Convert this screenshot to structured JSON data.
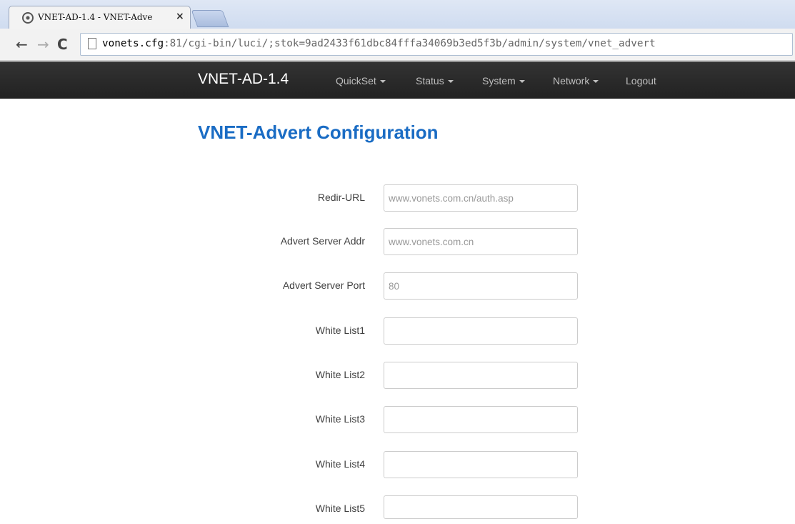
{
  "browser": {
    "tab_title": "VNET-AD-1.4 - VNET-Adve",
    "tab_close": "×",
    "url_host": "vonets.cfg",
    "url_rest": ":81/cgi-bin/luci/;stok=9ad2433f61dbc84fffa34069b3ed5f3b/admin/system/vnet_advert",
    "back": "←",
    "forward": "→",
    "reload": "C"
  },
  "navbar": {
    "brand": "VNET-AD-1.4",
    "menu": [
      {
        "label": "QuickSet"
      },
      {
        "label": "Status"
      },
      {
        "label": "System"
      },
      {
        "label": "Network"
      },
      {
        "label": "Logout"
      }
    ]
  },
  "page": {
    "title": "VNET-Advert Configuration"
  },
  "form": {
    "fields": [
      {
        "label": "Redir-URL",
        "placeholder": "www.vonets.com.cn/auth.asp",
        "value": ""
      },
      {
        "label": "Advert Server Addr",
        "placeholder": "www.vonets.com.cn",
        "value": ""
      },
      {
        "label": "Advert Server Port",
        "placeholder": "80",
        "value": ""
      },
      {
        "label": "White List1",
        "placeholder": "",
        "value": ""
      },
      {
        "label": "White List2",
        "placeholder": "",
        "value": ""
      },
      {
        "label": "White List3",
        "placeholder": "",
        "value": ""
      },
      {
        "label": "White List4",
        "placeholder": "",
        "value": ""
      },
      {
        "label": "White List5",
        "placeholder": "",
        "value": ""
      }
    ]
  },
  "colors": {
    "navbar_bg": "#222222",
    "title_blue": "#1a6cc4",
    "menu_text": "#bfbfbf"
  }
}
